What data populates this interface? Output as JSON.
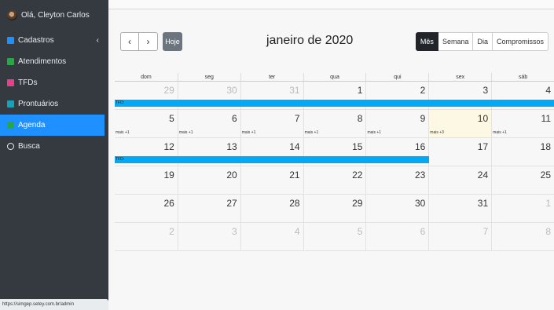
{
  "sidebar": {
    "user_label": "Olá, Cleyton Carlos",
    "items": [
      {
        "label": "Cadastros",
        "icon": "list-icon",
        "color": "#1e90ff",
        "has_chevron": true
      },
      {
        "label": "Atendimentos",
        "icon": "medkit-icon",
        "color": "#28a745"
      },
      {
        "label": "TFDs",
        "icon": "ambulance-icon",
        "color": "#e83e8c"
      },
      {
        "label": "Prontuários",
        "icon": "folder-icon",
        "color": "#17a2b8"
      },
      {
        "label": "Agenda",
        "icon": "calendar-icon",
        "color": "#28a745",
        "active": true
      },
      {
        "label": "Busca",
        "icon": "search-icon",
        "color": "#e9ecef"
      }
    ],
    "chevron": "‹",
    "status_url": "https://simgep.setey.com.br/admin"
  },
  "toolbar": {
    "prev": "‹",
    "next": "›",
    "today": "Hoje",
    "title": "janeiro de 2020",
    "views": [
      "Mês",
      "Semana",
      "Dia",
      "Compromissos"
    ],
    "active_view": "Mês"
  },
  "calendar": {
    "days_of_week": [
      "dom",
      "seg",
      "ter",
      "qua",
      "qui",
      "sex",
      "sáb"
    ],
    "weeks": [
      [
        {
          "n": "29",
          "other": true
        },
        {
          "n": "30",
          "other": true
        },
        {
          "n": "31",
          "other": true
        },
        {
          "n": "1"
        },
        {
          "n": "2"
        },
        {
          "n": "3"
        },
        {
          "n": "4"
        }
      ],
      [
        {
          "n": "5",
          "more": "mais +1"
        },
        {
          "n": "6",
          "more": "mais +1"
        },
        {
          "n": "7",
          "more": "mais +1"
        },
        {
          "n": "8",
          "more": "mais +1"
        },
        {
          "n": "9",
          "more": "mais +1"
        },
        {
          "n": "10",
          "more": "mais +3",
          "today": true
        },
        {
          "n": "11",
          "more": "mais +1"
        }
      ],
      [
        {
          "n": "12"
        },
        {
          "n": "13"
        },
        {
          "n": "14"
        },
        {
          "n": "15"
        },
        {
          "n": "16"
        },
        {
          "n": "17"
        },
        {
          "n": "18"
        }
      ],
      [
        {
          "n": "19"
        },
        {
          "n": "20"
        },
        {
          "n": "21"
        },
        {
          "n": "22"
        },
        {
          "n": "23"
        },
        {
          "n": "24"
        },
        {
          "n": "25"
        }
      ],
      [
        {
          "n": "26"
        },
        {
          "n": "27"
        },
        {
          "n": "28"
        },
        {
          "n": "29"
        },
        {
          "n": "30"
        },
        {
          "n": "31"
        },
        {
          "n": "1",
          "other": true
        }
      ],
      [
        {
          "n": "2",
          "other": true
        },
        {
          "n": "3",
          "other": true
        },
        {
          "n": "4",
          "other": true
        },
        {
          "n": "5",
          "other": true
        },
        {
          "n": "6",
          "other": true
        },
        {
          "n": "7",
          "other": true
        },
        {
          "n": "8",
          "other": true
        }
      ]
    ],
    "events": [
      {
        "label": "TFD:",
        "week": 0,
        "start_day": 0,
        "span_days": 7
      },
      {
        "label": "TFD:",
        "week": 2,
        "start_day": 0,
        "span_days": 5
      }
    ],
    "event_color": "#03a9f4",
    "today_color": "#fcf8e3"
  }
}
